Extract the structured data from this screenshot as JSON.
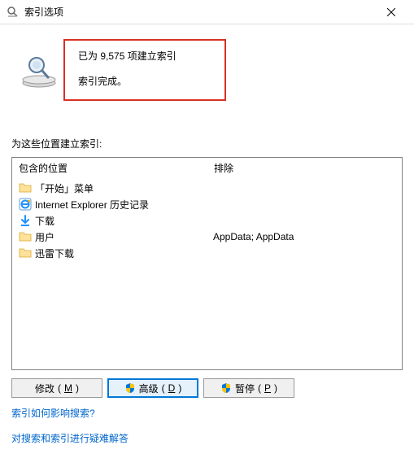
{
  "titlebar": {
    "title": "索引选项"
  },
  "status": {
    "count_line": "已为 9,575 项建立索引",
    "done_line": "索引完成。"
  },
  "section_label": "为这些位置建立索引:",
  "columns": {
    "included": "包含的位置",
    "exclude": "排除"
  },
  "locations": [
    {
      "icon": "folder",
      "name": "「开始」菜单",
      "exclude": ""
    },
    {
      "icon": "ie",
      "name": "Internet Explorer 历史记录",
      "exclude": ""
    },
    {
      "icon": "down",
      "name": "下载",
      "exclude": ""
    },
    {
      "icon": "folder",
      "name": "用户",
      "exclude": "AppData; AppData"
    },
    {
      "icon": "folder",
      "name": "迅雷下载",
      "exclude": ""
    }
  ],
  "buttons": {
    "modify": {
      "label": "修改",
      "mn": "M"
    },
    "advanced": {
      "label": "高级",
      "mn": "D"
    },
    "pause": {
      "label": "暂停",
      "mn": "P"
    }
  },
  "links": {
    "how_affects": "索引如何影响搜索?",
    "troubleshoot": "对搜索和索引进行疑难解答"
  }
}
